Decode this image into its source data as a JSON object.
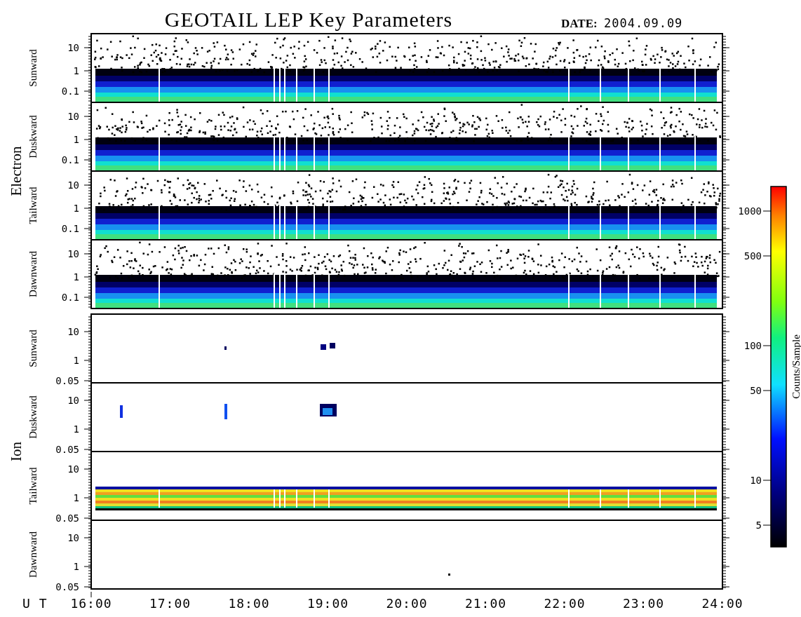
{
  "title": "GEOTAIL LEP Key Parameters",
  "date": {
    "label": "DATE:",
    "value": "2004.09.09"
  },
  "groups": [
    {
      "name": "Electron",
      "kind": "electron",
      "panels": [
        {
          "label": "Sunward",
          "kind": "dense",
          "yticks": [
            "10",
            "1",
            "0.1"
          ]
        },
        {
          "label": "Duskward",
          "kind": "dense",
          "yticks": [
            "10",
            "1",
            "0.1"
          ]
        },
        {
          "label": "Tailward",
          "kind": "dense",
          "yticks": [
            "10",
            "1",
            "0.1"
          ]
        },
        {
          "label": "Dawnward",
          "kind": "dense",
          "yticks": [
            "10",
            "1",
            "0.1"
          ]
        }
      ]
    },
    {
      "name": "Ion",
      "kind": "ion",
      "panels": [
        {
          "label": "Sunward",
          "kind": "spots",
          "yticks": [
            "10",
            "1",
            "0.05"
          ]
        },
        {
          "label": "Duskward",
          "kind": "blobs",
          "yticks": [
            "10",
            "1",
            "0.05"
          ]
        },
        {
          "label": "Tailward",
          "kind": "band",
          "yticks": [
            "10",
            "1",
            "0.05"
          ]
        },
        {
          "label": "Dawnward",
          "kind": "empty",
          "yticks": [
            "10",
            "1",
            "0.05"
          ]
        }
      ]
    }
  ],
  "time_axis": {
    "label": "U T",
    "ticks": [
      "16:00",
      "17:00",
      "18:00",
      "19:00",
      "20:00",
      "21:00",
      "22:00",
      "23:00",
      "24:00"
    ]
  },
  "colorbar": {
    "label": "Counts/Sample",
    "ticks": [
      "1000",
      "500",
      "100",
      "50",
      "10",
      "5"
    ]
  }
}
